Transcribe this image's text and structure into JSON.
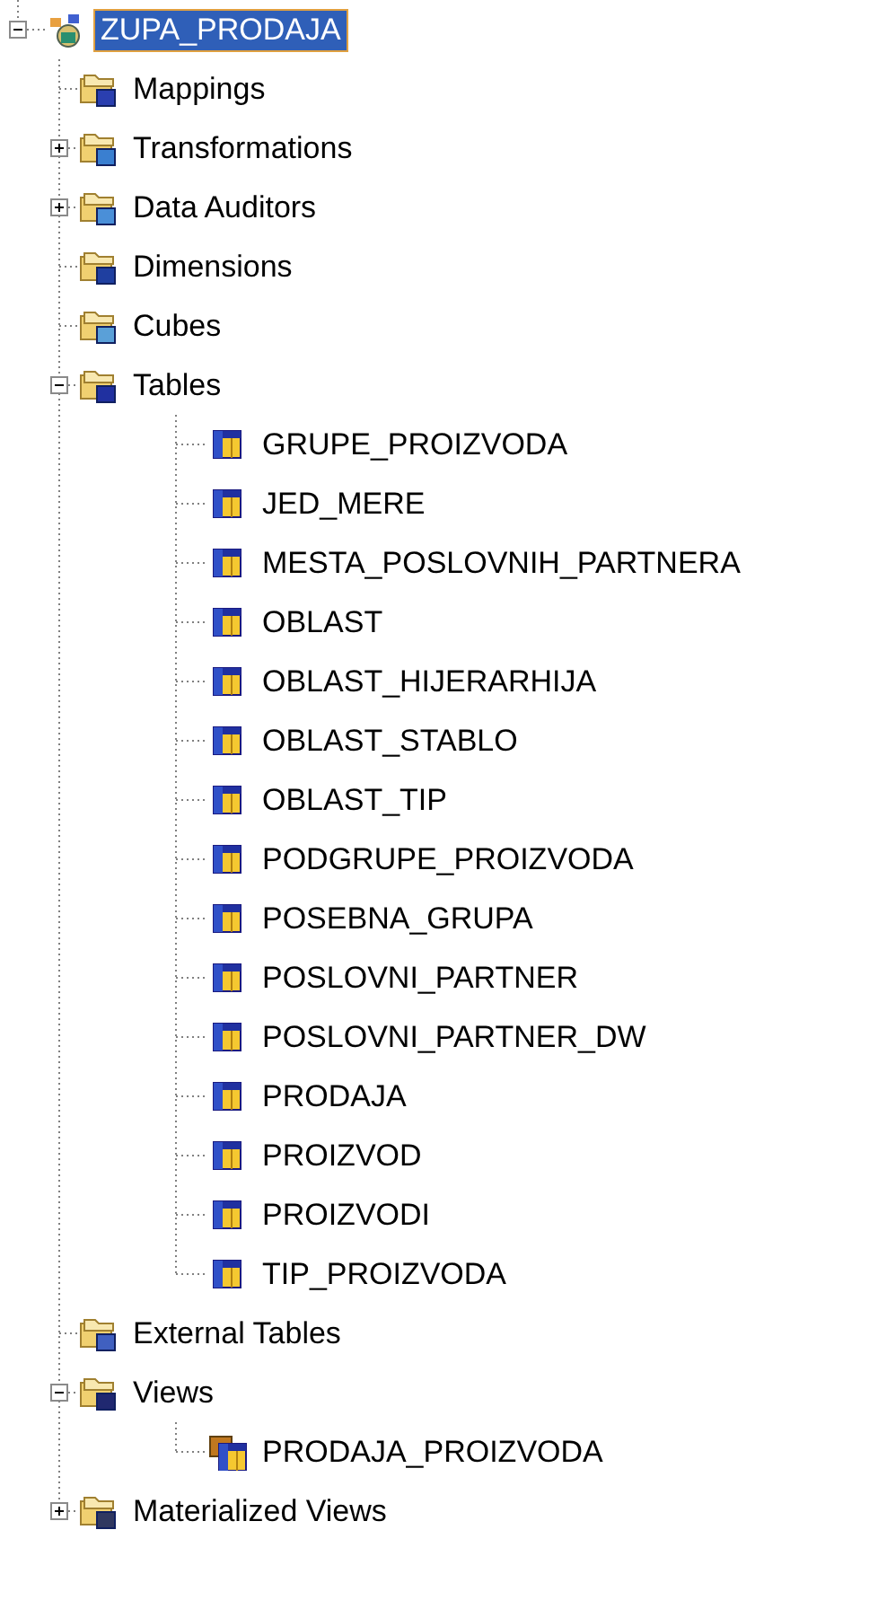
{
  "tree": [
    {
      "label": "ZUPA_PRODAJA",
      "kind": "project",
      "selected": true,
      "expanded": true,
      "children": [
        {
          "label": "Mappings",
          "kind": "mappings",
          "selected": false
        },
        {
          "label": "Transformations",
          "kind": "transformations",
          "selected": false,
          "expanded": false
        },
        {
          "label": "Data Auditors",
          "kind": "auditors",
          "selected": false,
          "expanded": false
        },
        {
          "label": "Dimensions",
          "kind": "dimensions",
          "selected": false
        },
        {
          "label": "Cubes",
          "kind": "cubes",
          "selected": false
        },
        {
          "label": "Tables",
          "kind": "tables",
          "selected": false,
          "expanded": true,
          "children": [
            {
              "label": "GRUPE_PROIZVODA",
              "kind": "table",
              "selected": false
            },
            {
              "label": "JED_MERE",
              "kind": "table",
              "selected": false
            },
            {
              "label": "MESTA_POSLOVNIH_PARTNERA",
              "kind": "table",
              "selected": false
            },
            {
              "label": "OBLAST",
              "kind": "table",
              "selected": false
            },
            {
              "label": "OBLAST_HIJERARHIJA",
              "kind": "table",
              "selected": false
            },
            {
              "label": "OBLAST_STABLO",
              "kind": "table",
              "selected": false
            },
            {
              "label": "OBLAST_TIP",
              "kind": "table",
              "selected": false
            },
            {
              "label": "PODGRUPE_PROIZVODA",
              "kind": "table",
              "selected": false
            },
            {
              "label": "POSEBNA_GRUPA",
              "kind": "table",
              "selected": false
            },
            {
              "label": "POSLOVNI_PARTNER",
              "kind": "table",
              "selected": false
            },
            {
              "label": "POSLOVNI_PARTNER_DW",
              "kind": "table",
              "selected": false
            },
            {
              "label": "PRODAJA",
              "kind": "table",
              "selected": false
            },
            {
              "label": "PROIZVOD",
              "kind": "table",
              "selected": false
            },
            {
              "label": "PROIZVODI",
              "kind": "table",
              "selected": false
            },
            {
              "label": "TIP_PROIZVODA",
              "kind": "table",
              "selected": false
            }
          ]
        },
        {
          "label": "External Tables",
          "kind": "external",
          "selected": false
        },
        {
          "label": "Views",
          "kind": "views",
          "selected": false,
          "expanded": true,
          "children": [
            {
              "label": "PRODAJA_PROIZVODA",
              "kind": "view",
              "selected": false
            }
          ]
        },
        {
          "label": "Materialized Views",
          "kind": "mviews",
          "selected": false,
          "expanded": false
        }
      ]
    }
  ]
}
